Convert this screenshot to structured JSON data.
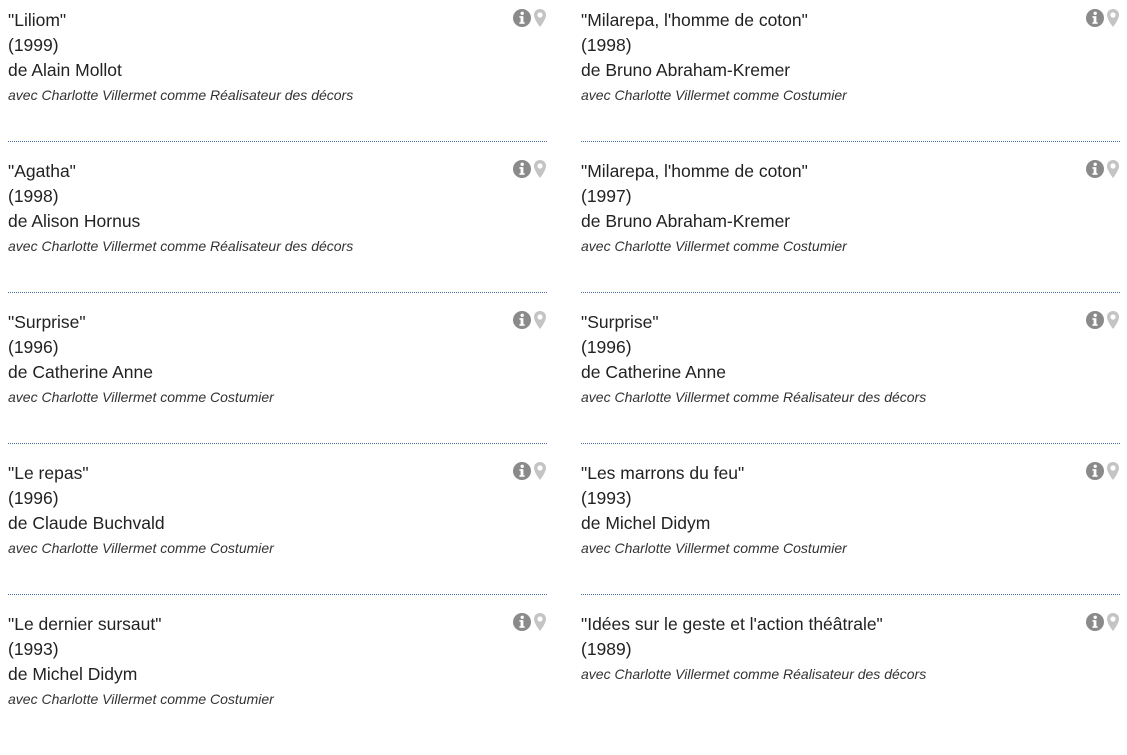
{
  "entries_left": [
    {
      "title": "\"Liliom\"",
      "year": "(1999)",
      "director": "de Alain Mollot",
      "role": "avec Charlotte Villermet comme Réalisateur des décors"
    },
    {
      "title": "\"Agatha\"",
      "year": "(1998)",
      "director": "de Alison Hornus",
      "role": "avec Charlotte Villermet comme Réalisateur des décors"
    },
    {
      "title": "\"Surprise\"",
      "year": "(1996)",
      "director": "de Catherine Anne",
      "role": "avec Charlotte Villermet comme Costumier"
    },
    {
      "title": "\"Le repas\"",
      "year": "(1996)",
      "director": "de Claude Buchvald",
      "role": "avec Charlotte Villermet comme Costumier"
    },
    {
      "title": "\"Le dernier sursaut\"",
      "year": "(1993)",
      "director": "de Michel Didym",
      "role": "avec Charlotte Villermet comme Costumier"
    }
  ],
  "entries_right": [
    {
      "title": "\"Milarepa, l'homme de coton\"",
      "year": "(1998)",
      "director": "de Bruno Abraham-Kremer",
      "role": "avec Charlotte Villermet comme Costumier"
    },
    {
      "title": "\"Milarepa, l'homme de coton\"",
      "year": "(1997)",
      "director": "de Bruno Abraham-Kremer",
      "role": "avec Charlotte Villermet comme Costumier"
    },
    {
      "title": "\"Surprise\"",
      "year": "(1996)",
      "director": "de Catherine Anne",
      "role": "avec Charlotte Villermet comme Réalisateur des décors"
    },
    {
      "title": "\"Les marrons du feu\"",
      "year": "(1993)",
      "director": "de Michel Didym",
      "role": "avec Charlotte Villermet comme Costumier"
    },
    {
      "title": "\"Idées sur le geste et l'action théâtrale\"",
      "year": "(1989)",
      "role": "avec Charlotte Villermet comme Réalisateur des décors"
    }
  ],
  "icons": {
    "info": "info-icon",
    "location": "map-pin-icon",
    "info_color": "#8a8a8a",
    "pin_color": "#c4c4c4"
  }
}
